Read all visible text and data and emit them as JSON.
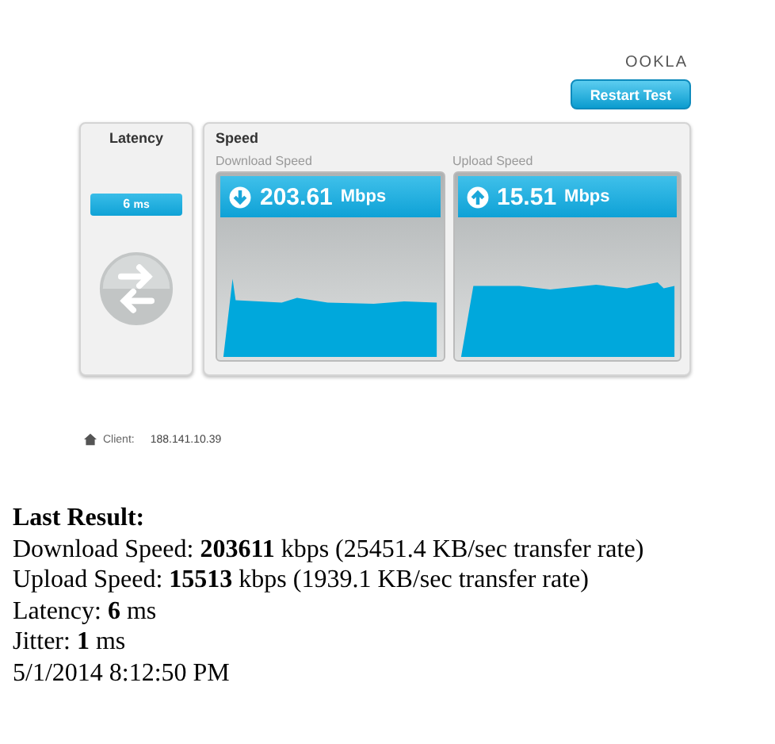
{
  "logo": "OOKLA",
  "restart_button": "Restart Test",
  "latency": {
    "title": "Latency",
    "value": "6",
    "unit": "ms"
  },
  "speed": {
    "title": "Speed",
    "meters": [
      {
        "kind": "download",
        "label": "Download Speed",
        "value": "203.61",
        "unit": "Mbps"
      },
      {
        "kind": "upload",
        "label": "Upload Speed",
        "value": "15.51",
        "unit": "Mbps"
      }
    ]
  },
  "client": {
    "label": "Client:",
    "ip": "188.141.10.39"
  },
  "last_result": {
    "title": "Last Result:",
    "lines": [
      "Download Speed: **203611** kbps (25451.4 KB/sec transfer rate)",
      "Upload Speed: **15513** kbps (1939.1 KB/sec transfer rate)",
      "Latency: **6** ms",
      "Jitter: **1** ms",
      "5/1/2014 8:12:50 PM"
    ]
  }
}
